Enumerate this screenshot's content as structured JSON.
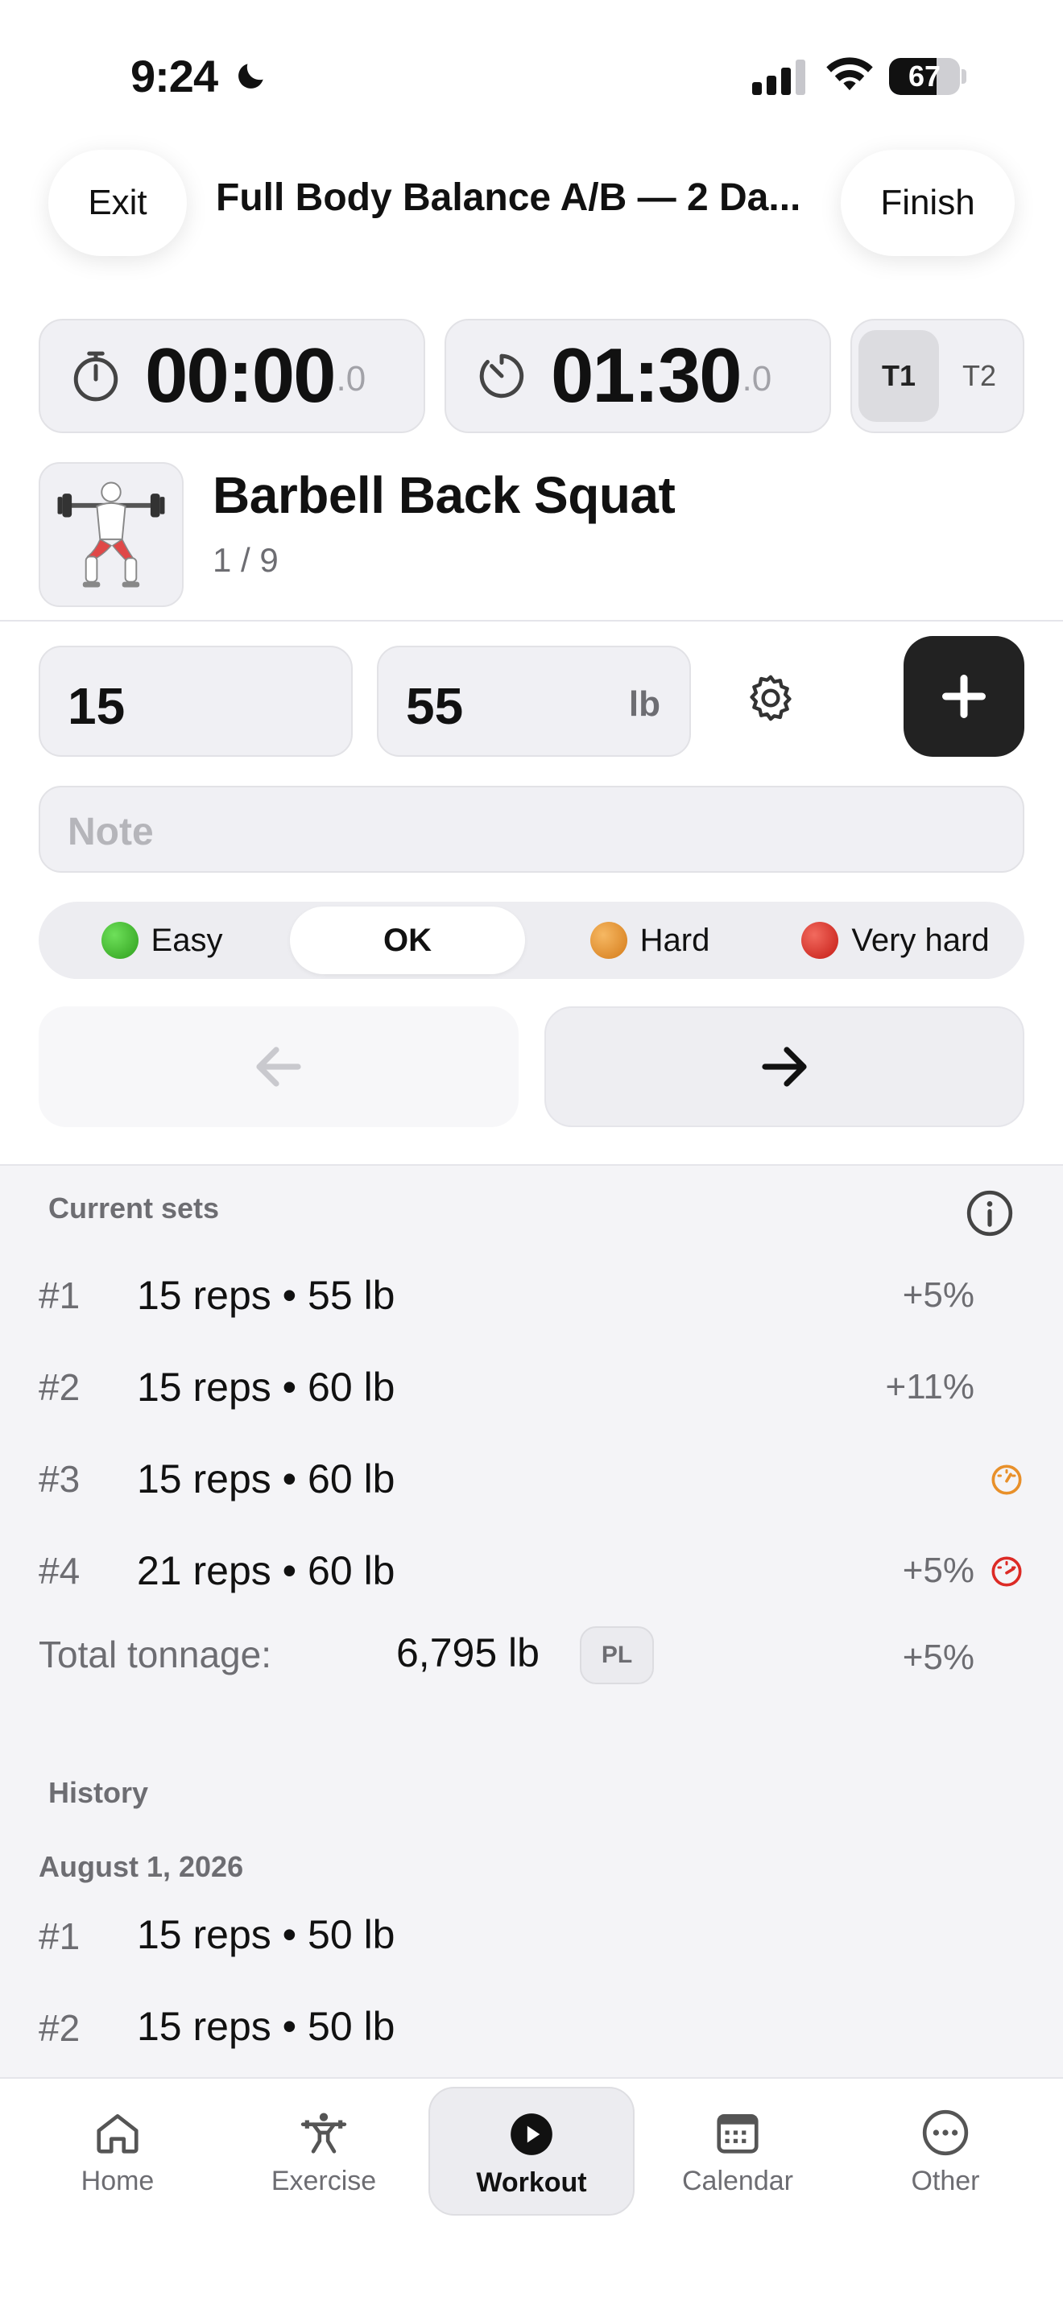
{
  "status": {
    "time": "9:24",
    "battery": 67
  },
  "header": {
    "exit_label": "Exit",
    "title": "Full Body Balance A/B — 2 Da...",
    "finish_label": "Finish"
  },
  "timers": {
    "stopwatch": {
      "main": "00:00",
      "frac": ".0"
    },
    "rest": {
      "main": "01:30",
      "frac": ".0"
    },
    "toggle": [
      {
        "label": "T1",
        "active": true
      },
      {
        "label": "T2",
        "active": false
      }
    ]
  },
  "exercise": {
    "name": "Barbell Back Squat",
    "progress": "1 / 9"
  },
  "entry": {
    "reps": "15",
    "weight": "55",
    "unit": "lb",
    "note_placeholder": "Note"
  },
  "difficulty": [
    {
      "label": "Easy",
      "color": "#3fb62a",
      "active": false
    },
    {
      "label": "OK",
      "color": "",
      "active": true
    },
    {
      "label": "Hard",
      "color": "#e8902a",
      "active": false
    },
    {
      "label": "Very hard",
      "color": "#dc2a25",
      "active": false
    }
  ],
  "current_sets": {
    "label": "Current sets",
    "rows": [
      {
        "num": "#1",
        "desc": "15 reps • 55 lb",
        "delta": "+5%",
        "effort": ""
      },
      {
        "num": "#2",
        "desc": "15 reps • 60 lb",
        "delta": "+11%",
        "effort": ""
      },
      {
        "num": "#3",
        "desc": "15 reps • 60 lb",
        "delta": "",
        "effort": "hard"
      },
      {
        "num": "#4",
        "desc": "21 reps • 60 lb",
        "delta": "+5%",
        "effort": "very-hard"
      }
    ],
    "total_label": "Total tonnage:",
    "total_value": "6,795 lb",
    "total_badge": "PL",
    "total_delta": "+5%"
  },
  "history": {
    "label": "History",
    "date": "August 1, 2026",
    "rows": [
      {
        "num": "#1",
        "desc": "15 reps • 50 lb"
      },
      {
        "num": "#2",
        "desc": "15 reps • 50 lb"
      }
    ]
  },
  "tabs": [
    {
      "label": "Home",
      "icon": "home-icon",
      "active": false
    },
    {
      "label": "Exercise",
      "icon": "weightlifter-icon",
      "active": false
    },
    {
      "label": "Workout",
      "icon": "play-icon",
      "active": true
    },
    {
      "label": "Calendar",
      "icon": "calendar-icon",
      "active": false
    },
    {
      "label": "Other",
      "icon": "more-icon",
      "active": false
    }
  ],
  "colors": {
    "accent_dark": "#222222",
    "hard": "#e8902a",
    "very_hard": "#dc2a25"
  }
}
